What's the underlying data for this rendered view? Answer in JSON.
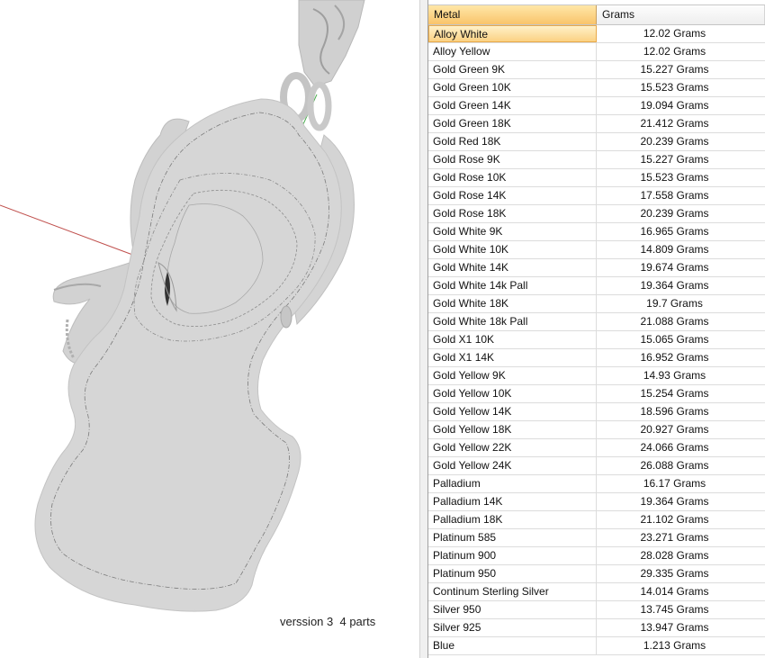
{
  "viewport": {
    "version_note": "verssion 3  4 parts"
  },
  "table": {
    "columns": [
      "Metal",
      "Grams"
    ],
    "rows": [
      {
        "metal": "Alloy White",
        "grams": "12.02 Grams"
      },
      {
        "metal": "Alloy Yellow",
        "grams": "12.02 Grams"
      },
      {
        "metal": "Gold Green 9K",
        "grams": "15.227 Grams"
      },
      {
        "metal": "Gold Green 10K",
        "grams": "15.523 Grams"
      },
      {
        "metal": "Gold Green 14K",
        "grams": "19.094 Grams"
      },
      {
        "metal": "Gold Green 18K",
        "grams": "21.412 Grams"
      },
      {
        "metal": "Gold Red 18K",
        "grams": "20.239 Grams"
      },
      {
        "metal": "Gold Rose 9K",
        "grams": "15.227 Grams"
      },
      {
        "metal": "Gold Rose 10K",
        "grams": "15.523 Grams"
      },
      {
        "metal": "Gold Rose 14K",
        "grams": "17.558 Grams"
      },
      {
        "metal": "Gold Rose 18K",
        "grams": "20.239 Grams"
      },
      {
        "metal": "Gold White 9K",
        "grams": "16.965 Grams"
      },
      {
        "metal": "Gold White 10K",
        "grams": "14.809 Grams"
      },
      {
        "metal": "Gold White 14K",
        "grams": "19.674 Grams"
      },
      {
        "metal": "Gold White 14k Pall",
        "grams": "19.364 Grams"
      },
      {
        "metal": "Gold White 18K",
        "grams": "19.7 Grams"
      },
      {
        "metal": "Gold White 18k Pall",
        "grams": "21.088 Grams"
      },
      {
        "metal": "Gold X1 10K",
        "grams": "15.065 Grams"
      },
      {
        "metal": "Gold X1 14K",
        "grams": "16.952 Grams"
      },
      {
        "metal": "Gold Yellow 9K",
        "grams": "14.93 Grams"
      },
      {
        "metal": "Gold Yellow 10K",
        "grams": "15.254 Grams"
      },
      {
        "metal": "Gold Yellow 14K",
        "grams": "18.596 Grams"
      },
      {
        "metal": "Gold Yellow 18K",
        "grams": "20.927 Grams"
      },
      {
        "metal": "Gold Yellow 22K",
        "grams": "24.066 Grams"
      },
      {
        "metal": "Gold Yellow 24K",
        "grams": "26.088 Grams"
      },
      {
        "metal": "Palladium",
        "grams": "16.17 Grams"
      },
      {
        "metal": "Palladium 14K",
        "grams": "19.364 Grams"
      },
      {
        "metal": "Palladium 18K",
        "grams": "21.102 Grams"
      },
      {
        "metal": "Platinum 585",
        "grams": "23.271 Grams"
      },
      {
        "metal": "Platinum 900",
        "grams": "28.028 Grams"
      },
      {
        "metal": "Platinum 950",
        "grams": "29.335 Grams"
      },
      {
        "metal": "Continum Sterling Silver",
        "grams": "14.014 Grams"
      },
      {
        "metal": "Silver 950",
        "grams": "13.745 Grams"
      },
      {
        "metal": "Silver 925",
        "grams": "13.947 Grams"
      },
      {
        "metal": "Blue",
        "grams": "1.213 Grams"
      }
    ]
  }
}
